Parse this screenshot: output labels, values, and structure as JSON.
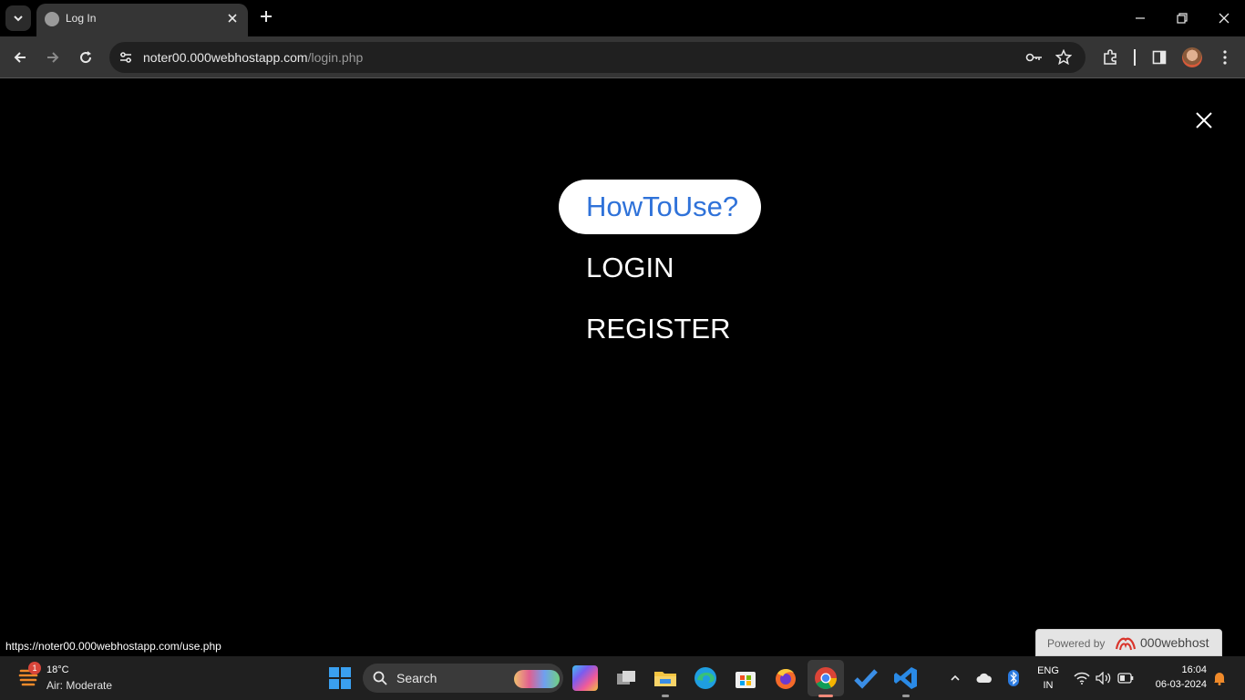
{
  "browser": {
    "tab_title": "Log In",
    "url_domain": "noter00.000webhostapp.com",
    "url_path": "/login.php"
  },
  "page": {
    "menu_items": [
      "HowToUse?",
      "LOGIN",
      "REGISTER"
    ],
    "highlight_color": "#2f72d9",
    "status_url": "https://noter00.000webhostapp.com/use.php",
    "powered_by_label": "Powered by",
    "powered_by_brand": "000webhost"
  },
  "taskbar": {
    "weather_badge": "1",
    "weather_temp": "18°C",
    "weather_desc": "Air: Moderate",
    "search_label": "Search",
    "lang_top": "ENG",
    "lang_bottom": "IN",
    "time": "16:04",
    "date": "06-03-2024",
    "apps": [
      "copilot-icon",
      "task-view-icon",
      "file-explorer-icon",
      "edge-icon",
      "store-icon",
      "firefox-icon",
      "chrome-icon",
      "todo-icon",
      "vscode-icon"
    ]
  }
}
